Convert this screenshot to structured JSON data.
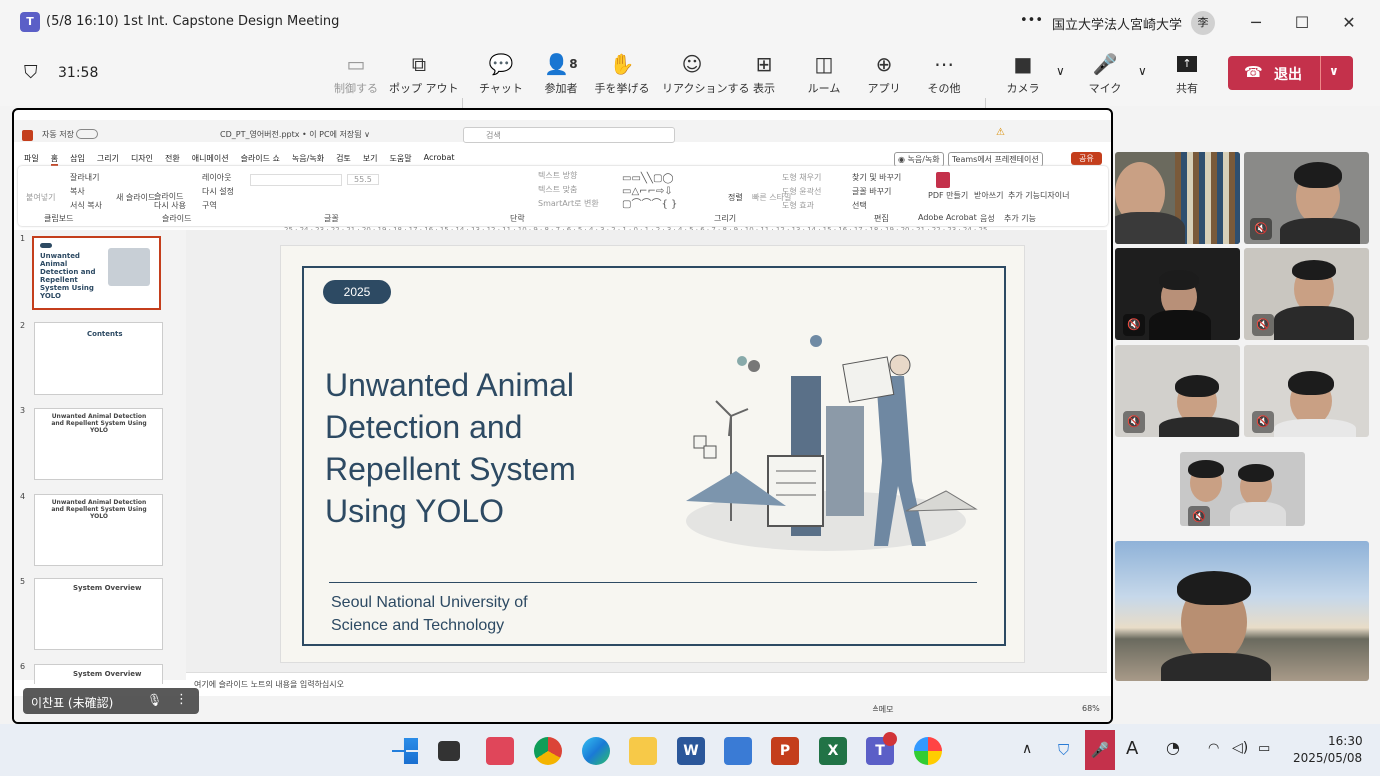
{
  "window": {
    "title": "(5/8 16:10) 1st Int. Capstone Design Meeting",
    "org": "国立大学法人宮崎大学",
    "avatar": "李",
    "more": "•••"
  },
  "meeting": {
    "timer": "31:58"
  },
  "toolbar": {
    "items": [
      {
        "label": "制御する",
        "icon": "control-icon"
      },
      {
        "label": "ポップ アウト",
        "icon": "popout-icon"
      },
      {
        "label": "チャット",
        "icon": "chat-icon"
      },
      {
        "label": "参加者",
        "icon": "people-icon",
        "count": "8"
      },
      {
        "label": "手を挙げる",
        "icon": "raise-hand-icon"
      },
      {
        "label": "リアクションする",
        "icon": "reaction-icon"
      },
      {
        "label": "表示",
        "icon": "view-icon"
      },
      {
        "label": "ルーム",
        "icon": "rooms-icon"
      },
      {
        "label": "アプリ",
        "icon": "apps-icon"
      },
      {
        "label": "その他",
        "icon": "more-icon"
      },
      {
        "label": "カメラ",
        "icon": "camera-icon"
      },
      {
        "label": "マイク",
        "icon": "mic-icon"
      },
      {
        "label": "共有",
        "icon": "share-icon"
      }
    ],
    "leave": "退出"
  },
  "ppt": {
    "autosave": "자동 저장",
    "filename": "CD_PT_영어버전.pptx • 이 PC에 저장됨 ∨",
    "search": "검색",
    "menu": [
      "파일",
      "홈",
      "삽입",
      "그리기",
      "디자인",
      "전환",
      "애니메이션",
      "슬라이드 쇼",
      "녹음/녹화",
      "검토",
      "보기",
      "도움말",
      "Acrobat"
    ],
    "record": "◉ 녹음/녹화",
    "teams": "Teams에서 프레젠테이션",
    "share": "공유",
    "groups": [
      "클립보드",
      "슬라이드",
      "글꼴",
      "단락",
      "그리기",
      "편집",
      "Adobe Acrobat",
      "음성",
      "추가 기능"
    ],
    "ribbon": {
      "paste": "붙여넣기",
      "cut": "잘라내기",
      "copy": "복사",
      "format": "서식 복사",
      "new_slide": "새 슬라이드",
      "reuse": "슬라이드 다시 사용",
      "layout": "레이아웃",
      "reset": "다시 설정",
      "section": "구역",
      "font_size": "55.5",
      "find": "찾기 및 바꾸기",
      "replace": "글꼴 바꾸기",
      "select": "선택",
      "pdf": "PDF 만들기",
      "dictate": "받아쓰기",
      "addins": "추가 기능",
      "designer": "디자이너",
      "arrange": "정렬",
      "quick": "빠른 스타일",
      "fill": "도형 채우기",
      "outline": "도형 윤곽선",
      "effect": "도형 효과",
      "text_dir": "텍스트 방향",
      "text_align": "텍스트 맞춤",
      "smartart": "SmartArt로 변환"
    },
    "ruler": "25 · 24 · 23 · 22 · 21 · 20 · 19 · 18 · 17 · 16 · 15 · 14 · 13 · 12 · 11 · 10 · 9 · 8 · 7 · 6 · 5 · 4 · 3 · 2 · 1 · 0 · 1 · 2 · 3 · 4 · 5 · 6 · 7 · 8 · 9 · 10 · 11 · 12 · 13 · 14 · 15 · 16 · 17 · 18 · 19 · 20 · 21 · 22 · 23 · 24 · 25",
    "thumbs": [
      {
        "n": "1",
        "t": "Unwanted Animal Detection and Repellent System Using YOLO"
      },
      {
        "n": "2",
        "t": "Contents"
      },
      {
        "n": "3",
        "t": "Unwanted Animal Detection and Repellent System Using YOLO"
      },
      {
        "n": "4",
        "t": "Unwanted Animal Detection and Repellent System Using YOLO"
      },
      {
        "n": "5",
        "t": "System Overview"
      },
      {
        "n": "6",
        "t": "System Overview"
      }
    ],
    "notes": "여기에 슬라이드 노트의 내용을 입력하십시오",
    "status": {
      "memo": "≜메모",
      "zoom": "68%"
    }
  },
  "slide": {
    "year": "2025",
    "title": [
      "Unwanted Animal",
      "Detection and",
      "Repellent System",
      "Using YOLO"
    ],
    "org": [
      "Seoul National University of",
      "Science and Technology"
    ]
  },
  "presenter": {
    "name": "이찬표 (未確認)"
  },
  "taskbar": {
    "time": "16:30",
    "date": "2025/05/08"
  },
  "colors": {
    "accent": "#c4314b",
    "ppt": "#c43e1c",
    "navy": "#2d4a63"
  }
}
